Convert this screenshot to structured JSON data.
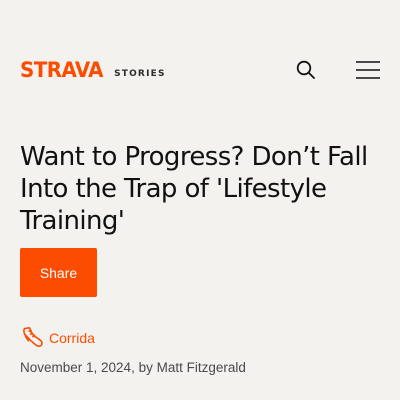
{
  "colors": {
    "brand": "#fc4c02",
    "background": "#f3f2ee",
    "text": "#111111"
  },
  "header": {
    "logo_text": "STRAVA",
    "logo_sub": "STORIES",
    "search_icon": "search-icon",
    "menu_icon": "hamburger-menu-icon"
  },
  "article": {
    "title": "Want to Progress? Don’t Fall Into the Trap of 'Lifestyle Training'",
    "share_label": "Share",
    "category_icon": "running-shoe-icon",
    "category": "Corrida",
    "date": "November 1, 2024",
    "byline_prefix": ", by ",
    "author": "Matt Fitzgerald"
  }
}
